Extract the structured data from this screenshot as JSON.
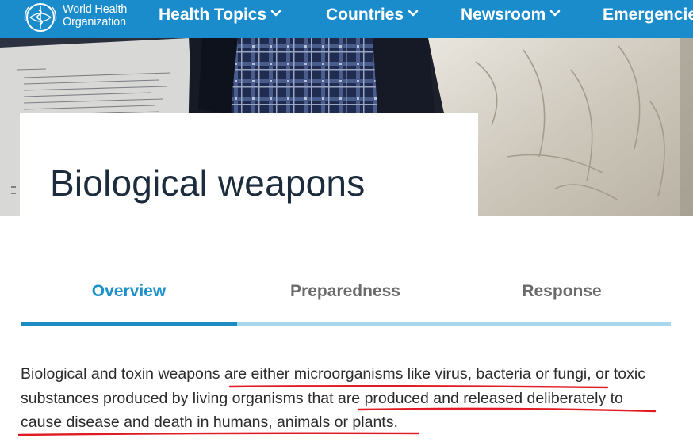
{
  "header": {
    "logo_line1": "World Health",
    "logo_line2": "Organization",
    "nav": [
      {
        "label": "Health Topics"
      },
      {
        "label": "Countries"
      },
      {
        "label": "Newsroom"
      },
      {
        "label": "Emergencies"
      }
    ]
  },
  "page": {
    "title": "Biological weapons"
  },
  "tabs": [
    {
      "label": "Overview",
      "active": true
    },
    {
      "label": "Preparedness",
      "active": false
    },
    {
      "label": "Response",
      "active": false
    }
  ],
  "content": {
    "line1_a": "Biological and toxin weapons ",
    "line1_b": "are either microorganisms like virus, bacteria or fungi,",
    "line1_c": " or toxic",
    "line2_a": "substances produced by living organisms that are ",
    "line2_b": "produced and released deliberately to",
    "line3": "cause disease and death in humans, animals or plants."
  },
  "colors": {
    "nav_bar": "#1a8ccc",
    "tab_active": "#1d91c9",
    "tab_track": "#a6d6e9",
    "annotation_underline": "#e01b24",
    "title_text": "#1c2c3c"
  }
}
